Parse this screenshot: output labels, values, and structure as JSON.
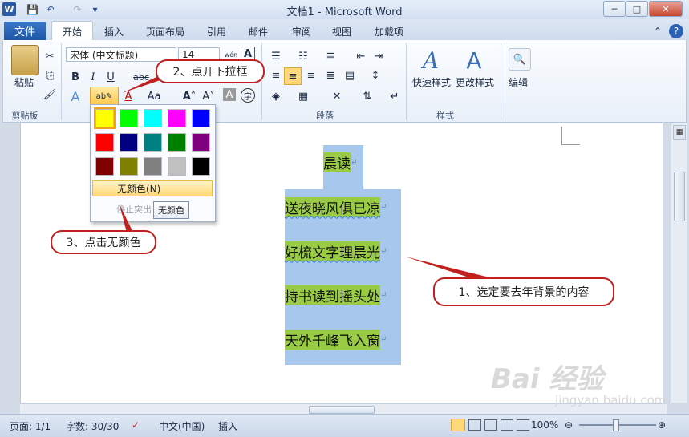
{
  "window": {
    "title": "文档1 - Microsoft Word",
    "app_icon": "W",
    "quick_access": [
      "save-icon",
      "undo-icon",
      "redo-icon",
      "customize-icon"
    ],
    "controls": {
      "minimize": "─",
      "maximize": "□",
      "close": "✕"
    }
  },
  "tabs": {
    "file": "文件",
    "items": [
      "开始",
      "插入",
      "页面布局",
      "引用",
      "邮件",
      "审阅",
      "视图",
      "加载项"
    ],
    "active": "开始"
  },
  "ribbon": {
    "clipboard": {
      "paste": "粘贴",
      "label": "剪贴板"
    },
    "font": {
      "font_name": "宋体 (中文标题)",
      "font_size": "14",
      "wen": "wén",
      "A_box": "A"
    },
    "paragraph": {
      "label": "段落"
    },
    "styles": {
      "quick": "快速样式",
      "change": "更改样式",
      "label": "样式"
    },
    "editing": {
      "label": "编辑"
    }
  },
  "palette": {
    "colors": [
      [
        "#ffff00",
        "#00ff00",
        "#00ffff",
        "#ff00ff",
        "#0000ff"
      ],
      [
        "#ff0000",
        "#000080",
        "#008080",
        "#008000",
        "#800080"
      ],
      [
        "#800000",
        "#808000",
        "#808080",
        "#c0c0c0",
        "#000000"
      ]
    ],
    "no_color": "无颜色(N)",
    "stop_highlight": "停止突出",
    "tooltip": "无颜色"
  },
  "document": {
    "title_line": "晨读",
    "lines": [
      "送夜晓风俱已凉",
      "好梳文字理晨光",
      "持书读到摇头处",
      "天外千峰飞入窗"
    ],
    "highlight_color": "#99cc44",
    "selection_color": "#a7c8ec"
  },
  "callouts": {
    "step1": "1、选定要去年背景的内容",
    "step2": "2、点开下拉框",
    "step3": "3、点击无颜色"
  },
  "status": {
    "page": "页面: 1/1",
    "words": "字数: 30/30",
    "language": "中文(中国)",
    "mode": "插入",
    "zoom": "100%"
  },
  "watermark": {
    "text": "Bai 经验",
    "url": "jingyan.baidu.com"
  }
}
